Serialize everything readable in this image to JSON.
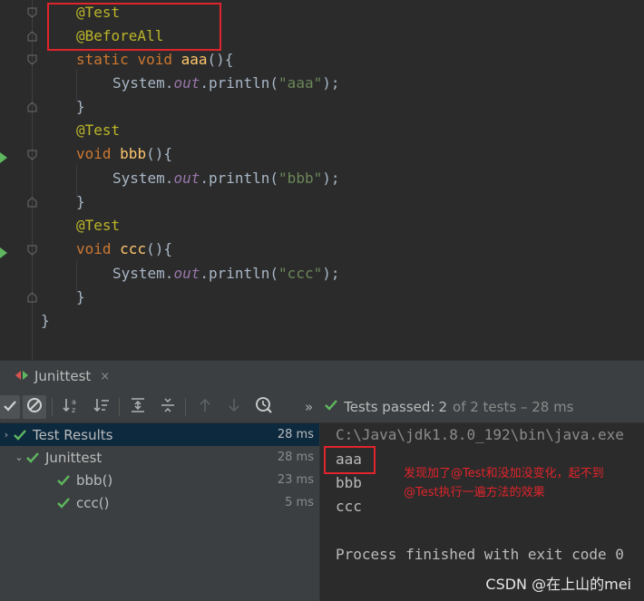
{
  "editor": {
    "lines": [
      {
        "a": "@Test"
      },
      {
        "a": "@BeforeAll"
      },
      {
        "k1": "static",
        "k2": "void",
        "f": "aaa",
        "rest": "(){"
      },
      {
        "p1": "System.",
        "sf": "out",
        "p2": ".println(",
        "s": "\"aaa\"",
        "p3": ");"
      },
      {
        "p": "}"
      },
      {
        "a": "@Test"
      },
      {
        "k": "void",
        "f": "bbb",
        "rest": "(){"
      },
      {
        "p1": "System.",
        "sf": "out",
        "p2": ".println(",
        "s": "\"bbb\"",
        "p3": ");"
      },
      {
        "p": "}"
      },
      {
        "a": "@Test"
      },
      {
        "k": "void",
        "f": "ccc",
        "rest": "(){"
      },
      {
        "p1": "System.",
        "sf": "out",
        "p2": ".println(",
        "s": "\"ccc\"",
        "p3": ");"
      },
      {
        "p": "}"
      },
      {
        "p": "}"
      }
    ]
  },
  "tool_window": {
    "tab_label": "Junittest",
    "tab_close": "×",
    "status": {
      "label": "Tests passed:",
      "passed": "2",
      "detail": "of 2 tests – 28 ms",
      "expand": "»"
    }
  },
  "tree": {
    "rows": [
      {
        "label": "Test Results",
        "time": "28 ms",
        "chev": "›"
      },
      {
        "label": "Junittest",
        "time": "28 ms",
        "chev": "⌄"
      },
      {
        "label": "bbb()",
        "time": "23 ms"
      },
      {
        "label": "ccc()",
        "time": "5 ms"
      }
    ]
  },
  "console": {
    "path": "C:\\Java\\jdk1.8.0_192\\bin\\java.exe",
    "out1": "aaa",
    "out2": "bbb",
    "out3": "ccc",
    "exit": "Process finished with exit code 0",
    "note_line1": "发现加了@Test和没加没变化，起不到",
    "note_line2": "@Test执行一遍方法的效果",
    "watermark": "CSDN @在上山的mei"
  },
  "colors": {
    "annotation": "#bbb529",
    "keyword": "#cc7832",
    "method": "#ffc66d",
    "string": "#6a8759",
    "static_field": "#9876aa",
    "highlight_box": "#e0242b",
    "pass_green": "#5fb85f"
  },
  "icons": [
    "run-gutter-icon",
    "fold-icon",
    "junit-icon",
    "check-icon",
    "cancel-icon",
    "sort-alpha-icon",
    "sort-duration-icon",
    "expand-all-icon",
    "collapse-all-icon",
    "prev-failed-icon",
    "next-failed-icon",
    "history-icon"
  ]
}
